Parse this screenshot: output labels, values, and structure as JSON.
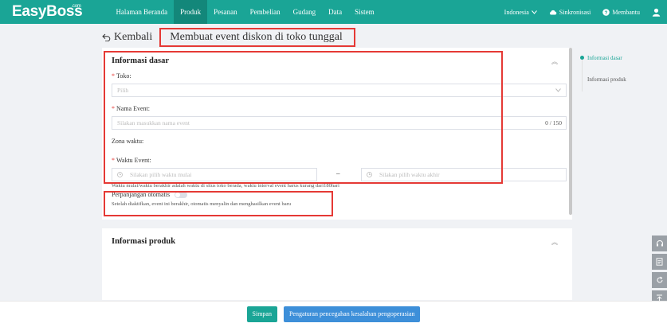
{
  "topbar": {
    "logo": "EasyBoss",
    "logo_sup": ".com",
    "nav": [
      "Halaman Beranda",
      "Produk",
      "Pesanan",
      "Pembelian",
      "Gudang",
      "Data",
      "Sistem"
    ],
    "active_nav": "Produk",
    "language": "Indonesia",
    "sync_label": "Sinkronisasi",
    "help_label": "Membantu"
  },
  "header": {
    "back_label": "Kembali",
    "page_title": "Membuat event diskon di toko tunggal"
  },
  "basic_info": {
    "section_title": "Informasi dasar",
    "store_label": "Toko:",
    "store_placeholder": "Pilih",
    "event_name_label": "Nama Event:",
    "event_name_placeholder": "Silakan masukkan nama event",
    "event_name_counter": "0 / 150",
    "timezone_label": "Zona waktu:",
    "event_time_label": "Waktu Event:",
    "start_placeholder": "Silakan pilih waktu mulai",
    "range_separator": "–",
    "end_placeholder": "Silakan pilih waktu akhir",
    "time_hint": "Waktu mulai/waktu berakhir adalah waktu di situs toko berada, waktu interval event harus kurang dari180hari",
    "auto_renew_label": "Perpanjangan otomatis",
    "auto_renew_hint": "Setelah diaktifkan, event ini berakhir, otomatis menyalin dan menghasilkan event baru"
  },
  "product_info": {
    "section_title": "Informasi produk"
  },
  "anchors": [
    {
      "label": "Informasi dasar",
      "active": true
    },
    {
      "label": "Informasi produk",
      "active": false
    }
  ],
  "footer": {
    "save_label": "Simpan",
    "config_label": "Pengaturan pencegahan kesalahan pengoperasian"
  },
  "colors": {
    "brand": "#1aa596",
    "primary_blue": "#3d8fd9",
    "required": "#e53935"
  },
  "side_tools": [
    "headset-icon",
    "document-icon",
    "refresh-icon",
    "back-to-top-icon"
  ]
}
